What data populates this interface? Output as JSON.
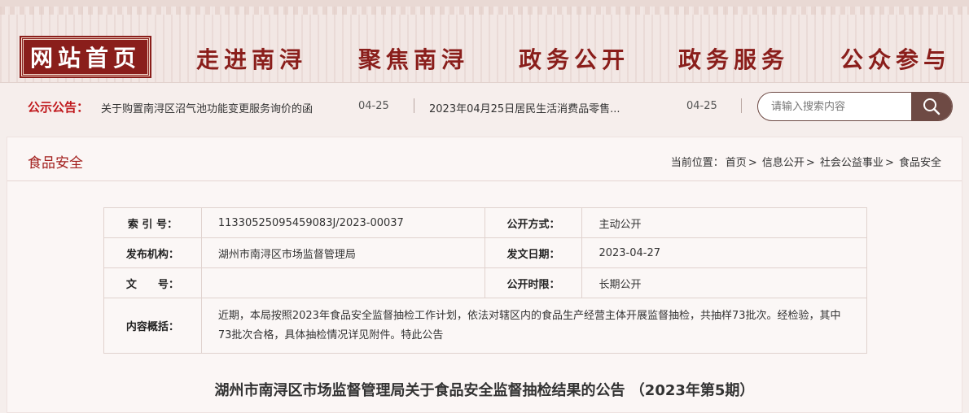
{
  "nav": {
    "home": "网站首页",
    "items": [
      "走进南浔",
      "聚焦南浔",
      "政务公开",
      "政务服务",
      "公众参与"
    ]
  },
  "notice": {
    "title": "公示公告：",
    "items": [
      {
        "text": "关于购置南浔区沼气池功能变更服务询价的函",
        "date": "04-25"
      },
      {
        "text": "2023年04月25日居民生活消费品零售...",
        "date": "04-25"
      }
    ]
  },
  "search": {
    "placeholder": "请输入搜索内容",
    "icon": "search-icon"
  },
  "section": {
    "title": "食品安全"
  },
  "breadcrumb": {
    "prefix": "当前位置：",
    "items": [
      "首页",
      "信息公开",
      "社会公益事业",
      "食品安全"
    ],
    "separator": ">"
  },
  "info": {
    "index_label": "索 引 号：",
    "index_value": "11330525095459083J/2023-00037",
    "mode_label": "公开方式：",
    "mode_value": "主动公开",
    "org_label": "发布机构：",
    "org_value": "湖州市南浔区市场监督管理局",
    "date_label": "发文日期：",
    "date_value": "2023-04-27",
    "doc_label": "文　　号：",
    "doc_value": "",
    "limit_label": "公开时限：",
    "limit_value": "长期公开",
    "summary_label": "内容概括：",
    "summary_value": "近期，本局按照2023年食品安全监督抽检工作计划，依法对辖区内的食品生产经营主体开展监督抽检，共抽样73批次。经检验，其中73批次合格，具体抽检情况详见附件。特此公告"
  },
  "document": {
    "title": "湖州市南浔区市场监督管理局关于食品安全监督抽检结果的公告 （2023年第5期）"
  },
  "colors": {
    "brand": "#8a1e1b",
    "notice_red": "#c0181c",
    "search_btn": "#6e4a44"
  }
}
